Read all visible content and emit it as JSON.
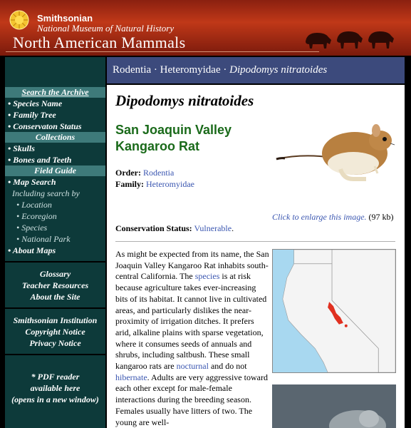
{
  "header": {
    "institution": "Smithsonian",
    "museum": "National Museum of Natural History",
    "site_title": "North American Mammals"
  },
  "breadcrumb": {
    "order": "Rodentia",
    "family": "Heteromyidae",
    "species": "Dipodomys nitratoides",
    "separator": "·"
  },
  "sidebar": {
    "search_archive": "Search the Archive",
    "species_name": "• Species Name",
    "family_tree": "• Family Tree",
    "conservation_status": "• Conservaton Status",
    "collections": "Collections",
    "skulls": "• Skulls",
    "bones_teeth": "• Bones and Teeth",
    "field_guide": "Field Guide",
    "map_search": "• Map Search",
    "including": "Including search by",
    "location": "• Location",
    "ecoregion": "• Ecoregion",
    "species": "• Species",
    "national_park": "• National Park",
    "about_maps": "• About Maps",
    "glossary": "Glossary",
    "teacher_resources": "Teacher Resources",
    "about_site": "About the Site",
    "smithsonian_institution": "Smithsonian Institution",
    "copyright": "Copyright Notice",
    "privacy": "Privacy Notice",
    "pdf_line1": "* PDF reader",
    "pdf_line2": "available here",
    "pdf_line3": "(opens in a new window)"
  },
  "content": {
    "scientific_name": "Dipodomys nitratoides",
    "common_name_line1": "San Joaquin Valley",
    "common_name_line2": "Kangaroo Rat",
    "order_label": "Order:",
    "order_value": "Rodentia",
    "family_label": "Family:",
    "family_value": "Heteromyidae",
    "conservation_label": "Conservation Status:",
    "conservation_value": "Vulnerable",
    "enlarge_text": "Click to enlarge this image.",
    "image_size": "(97 kb)",
    "text_1": "As might be expected from its name, the San Joaquin Valley Kangaroo Rat inhabits south-central California. The ",
    "link_species": "species",
    "text_2": " is at risk because agriculture takes ever-increasing bits of its habitat. It cannot live in cultivated areas, and particularly dislikes the near-proximity of irrigation ditches. It prefers arid, alkaline plains with sparse vegetation, where it consumes seeds of annuals and shrubs, including saltbush. These small kangaroo rats are ",
    "link_nocturnal": "nocturnal",
    "text_3": " and do not ",
    "link_hibernate": "hibernate",
    "text_4": ". Adults are very aggressive toward each other except for male-female interactions during the breeding season. Females usually have litters of two. The young are well-"
  },
  "colors": {
    "header_red": "#b03016",
    "sidebar_bg": "#0d3a3a",
    "sidebar_head": "#3e7a7a",
    "breadcrumb_bg": "#3c4a7c",
    "common_name_green": "#1a6a1a",
    "link_blue": "#3a56b0",
    "map_range": "#e03020"
  },
  "icons": [
    "smithsonian-sun-logo",
    "muskox-silhouettes",
    "kangaroo-rat-illustration",
    "range-map",
    "animal-photo"
  ]
}
